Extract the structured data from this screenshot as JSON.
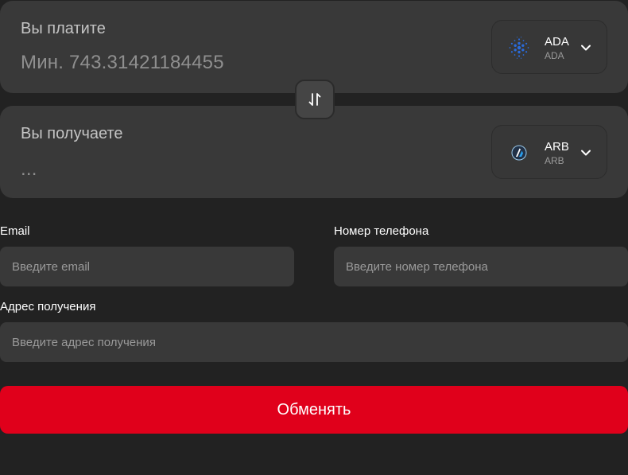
{
  "pay": {
    "label": "Вы платите",
    "amount": "Мин. 743.31421184455",
    "currency": {
      "code": "ADA",
      "network": "ADA",
      "icon": "cardano-icon"
    }
  },
  "receive": {
    "label": "Вы получаете",
    "amount": "...",
    "currency": {
      "code": "ARB",
      "network": "ARB",
      "icon": "arbitrum-icon"
    }
  },
  "swap_icon": "swap-arrows-icon",
  "form": {
    "email": {
      "label": "Email",
      "placeholder": "Введите email"
    },
    "phone": {
      "label": "Номер телефона",
      "placeholder": "Введите номер телефона"
    },
    "address": {
      "label": "Адрес получения",
      "placeholder": "Введите адрес получения"
    }
  },
  "submit_label": "Обменять",
  "colors": {
    "background": "#222222",
    "card": "#393939",
    "accent": "#e0001b",
    "cardano_blue": "#2a6bdc",
    "arbitrum_blue": "#28a0f0"
  }
}
